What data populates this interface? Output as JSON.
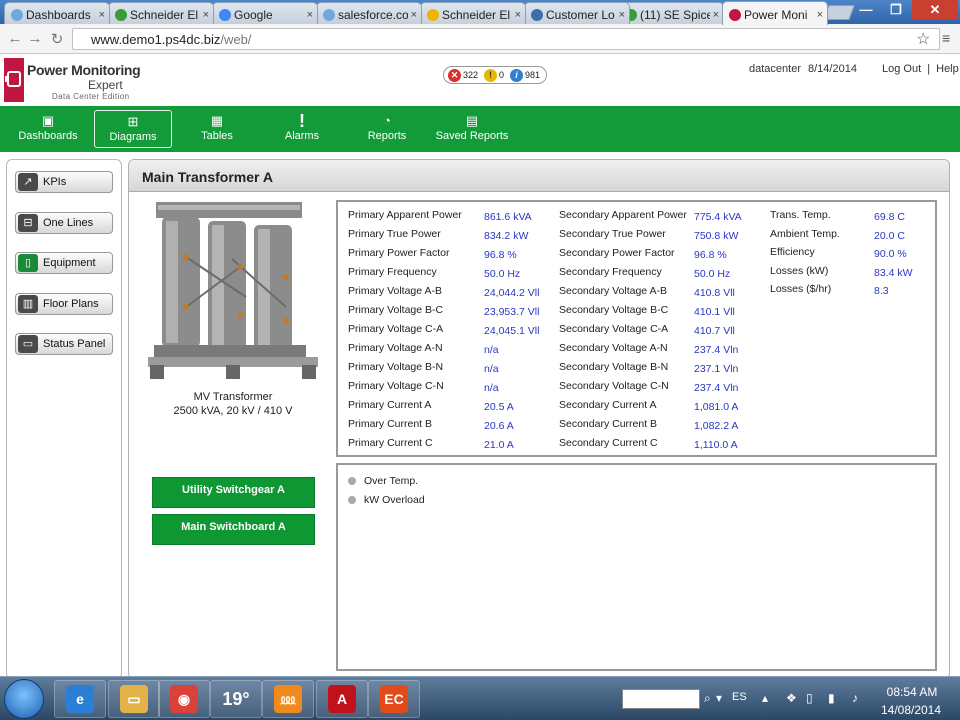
{
  "browser": {
    "tabs": [
      {
        "title": "Dashboards",
        "icon": "cloud-icon",
        "color": "#6fa8dc"
      },
      {
        "title": "Schneider El",
        "icon": "schneider-icon",
        "color": "#3a9a3a"
      },
      {
        "title": "Google",
        "icon": "google-icon",
        "color": "#4285f4"
      },
      {
        "title": "salesforce.co",
        "icon": "cloud-icon",
        "color": "#6fa8dc"
      },
      {
        "title": "Schneider El",
        "icon": "schneider-icon",
        "color": "#f0b400"
      },
      {
        "title": "Customer Lo",
        "icon": "customer-icon",
        "color": "#3b6ea8"
      },
      {
        "title": "(11) SE Spice",
        "icon": "spice-icon",
        "color": "#3a9a3a"
      },
      {
        "title": "Power Moni",
        "icon": "power-icon",
        "color": "#c0163f"
      }
    ],
    "url_host": "www.demo1.ps4dc.biz",
    "url_path": "/web/"
  },
  "header": {
    "logo_title": "Power Monitoring",
    "logo_subtitle": "Expert",
    "logo_edition": "Data Center Edition",
    "alarm_counts": {
      "high": "322",
      "medium": "0",
      "low": "981"
    },
    "user": "datacenter",
    "date": "8/14/2014",
    "logout": "Log Out",
    "separator": "|",
    "help": "Help"
  },
  "nav": [
    {
      "label": "Dashboards",
      "icon": "dashboard-icon",
      "selected": false
    },
    {
      "label": "Diagrams",
      "icon": "diagram-icon",
      "selected": true
    },
    {
      "label": "Tables",
      "icon": "table-icon",
      "selected": false
    },
    {
      "label": "Alarms",
      "icon": "alarm-icon",
      "selected": false
    },
    {
      "label": "Reports",
      "icon": "report-icon",
      "selected": false
    },
    {
      "label": "Saved Reports",
      "icon": "saved-report-icon",
      "selected": false
    }
  ],
  "sidebar": [
    {
      "label": "KPIs",
      "icon": "kpi-icon"
    },
    {
      "label": "One Lines",
      "icon": "one-lines-icon"
    },
    {
      "label": "Equipment",
      "icon": "equipment-icon"
    },
    {
      "label": "Floor Plans",
      "icon": "floor-plans-icon"
    },
    {
      "label": "Status Panel",
      "icon": "status-panel-icon"
    }
  ],
  "panel": {
    "title": "Main Transformer A",
    "equipment_name": "MV Transformer",
    "equipment_spec": "2500 kVA, 20 kV / 410 V",
    "links": [
      "Utility Switchgear A",
      "Main Switchboard A"
    ]
  },
  "readings": {
    "primary": [
      {
        "label": "Primary Apparent Power",
        "value": "861.6 kVA"
      },
      {
        "label": "Primary True Power",
        "value": "834.2 kW"
      },
      {
        "label": "Primary Power Factor",
        "value": "96.8 %"
      },
      {
        "label": "Primary Frequency",
        "value": "50.0 Hz"
      },
      {
        "label": "Primary Voltage A-B",
        "value": "24,044.2 Vll"
      },
      {
        "label": "Primary Voltage B-C",
        "value": "23,953.7 Vll"
      },
      {
        "label": "Primary Voltage C-A",
        "value": "24,045.1 Vll"
      },
      {
        "label": "Primary Voltage A-N",
        "value": "n/a"
      },
      {
        "label": "Primary Voltage B-N",
        "value": "n/a"
      },
      {
        "label": "Primary Voltage C-N",
        "value": "n/a"
      },
      {
        "label": "Primary Current A",
        "value": "20.5 A"
      },
      {
        "label": "Primary Current B",
        "value": "20.6 A"
      },
      {
        "label": "Primary Current C",
        "value": "21.0 A"
      }
    ],
    "secondary": [
      {
        "label": "Secondary Apparent Power",
        "value": "775.4 kVA"
      },
      {
        "label": "Secondary True Power",
        "value": "750.8 kW"
      },
      {
        "label": "Secondary Power Factor",
        "value": "96.8 %"
      },
      {
        "label": "Secondary Frequency",
        "value": "50.0 Hz"
      },
      {
        "label": "Secondary Voltage A-B",
        "value": "410.8 Vll"
      },
      {
        "label": "Secondary Voltage B-C",
        "value": "410.1 Vll"
      },
      {
        "label": "Secondary Voltage C-A",
        "value": "410.7 Vll"
      },
      {
        "label": "Secondary Voltage A-N",
        "value": "237.4 Vln"
      },
      {
        "label": "Secondary Voltage B-N",
        "value": "237.1 Vln"
      },
      {
        "label": "Secondary Voltage C-N",
        "value": "237.4 Vln"
      },
      {
        "label": "Secondary Current A",
        "value": "1,081.0 A"
      },
      {
        "label": "Secondary Current B",
        "value": "1,082.2 A"
      },
      {
        "label": "Secondary Current C",
        "value": "1,110.0 A"
      }
    ],
    "other": [
      {
        "label": "Trans. Temp.",
        "value": "69.8 C"
      },
      {
        "label": "Ambient Temp.",
        "value": "20.0 C"
      },
      {
        "label": "Efficiency",
        "value": "90.0 %"
      },
      {
        "label": "Losses (kW)",
        "value": "83.4 kW"
      },
      {
        "label": "Losses ($/hr)",
        "value": "8.3"
      }
    ]
  },
  "alarms": [
    {
      "label": "Over Temp.",
      "status_color": "#aaaaaa"
    },
    {
      "label": "kW Overload",
      "status_color": "#aaaaaa"
    }
  ],
  "taskbar": {
    "apps": [
      {
        "name": "ie-icon",
        "glyph": "e",
        "color": "#2a7fd4"
      },
      {
        "name": "folder-icon",
        "glyph": "▭",
        "color": "#e3b34a"
      },
      {
        "name": "chrome-icon",
        "glyph": "◉",
        "color": "#d9423a"
      },
      {
        "name": "weather-icon",
        "glyph": "19°",
        "color": "#4a6e94"
      },
      {
        "name": "app-orange-icon",
        "glyph": "⅏",
        "color": "#f08a1c"
      },
      {
        "name": "acrobat-icon",
        "glyph": "A",
        "color": "#c1121c"
      },
      {
        "name": "ec-icon",
        "glyph": "EC",
        "color": "#e24a1a"
      }
    ],
    "language": "ES",
    "time": "08:54 AM",
    "date": "14/08/2014"
  },
  "colors": {
    "brand_green": "#139a39",
    "brand_red": "#c0163f",
    "value_blue": "#2a36c4"
  }
}
